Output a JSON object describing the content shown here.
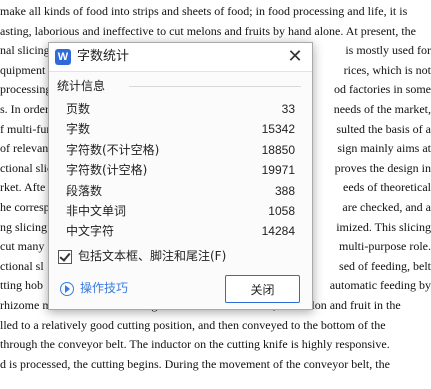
{
  "document": {
    "lines": [
      {
        "left": "make all kinds of food into strips and sheets of food; in food processing and life, it is",
        "right": ""
      },
      {
        "left": "asting, laborious and ineffective to cut melons and fruits by hand alone. At present, the",
        "right": ""
      },
      {
        "left": "nal slicing",
        "right": "is mostly used for"
      },
      {
        "left": "quipment",
        "right": "rices, which is not"
      },
      {
        "left": "processing",
        "right": "od factories in some"
      },
      {
        "left": "s. In order",
        "right": "needs of the market,"
      },
      {
        "left": "f multi-fun",
        "right": "sulted the basis of a"
      },
      {
        "left": "of relevan",
        "right": "sign mainly aims at"
      },
      {
        "left": "ctional slic",
        "right": "proves the design in"
      },
      {
        "left": "rket. Afte",
        "right": "eeds of theoretical"
      },
      {
        "left": "he corresp",
        "right": "are checked, and a"
      },
      {
        "left": "ng slicing",
        "right": "imized. This slicing"
      },
      {
        "left": "cut many",
        "right": "multi-purpose role."
      },
      {
        "left": "ctional sl",
        "right": "sed of feeding, belt"
      },
      {
        "left": "tting hob",
        "right": "automatic feeding by"
      },
      {
        "left": "rhizome melon and fruit. Through the rotation of the hob, the melon and fruit in the",
        "right": ""
      },
      {
        "left": "lled to a relatively good cutting position, and then conveyed to the bottom of the",
        "right": ""
      },
      {
        "left": "through the conveyor belt. The inductor on the cutting knife is highly responsive.",
        "right": ""
      },
      {
        "left": "d is processed, the cutting begins. During the movement of the conveyor belt, the",
        "right": ""
      }
    ]
  },
  "dialog": {
    "app_icon_letter": "W",
    "title": "字数统计",
    "close_glyph": "✕",
    "group_label": "统计信息",
    "stats": [
      {
        "label": "页数",
        "value": "33"
      },
      {
        "label": "字数",
        "value": "15342"
      },
      {
        "label": "字符数(不计空格)",
        "value": "18850"
      },
      {
        "label": "字符数(计空格)",
        "value": "19971"
      },
      {
        "label": "段落数",
        "value": "388"
      },
      {
        "label": "非中文单词",
        "value": "1058"
      },
      {
        "label": "中文字符",
        "value": "14284"
      }
    ],
    "include_checkbox": {
      "label": "包括文本框、脚注和尾注(F)",
      "checked": true
    },
    "tips_link": "操作技巧",
    "close_button": "关闭"
  },
  "colors": {
    "accent": "#2f6bd8",
    "link": "#3b7be0"
  },
  "icons": {
    "app": "wps-writer-icon",
    "close": "close-icon",
    "tips": "play-circle-icon",
    "checkbox": "checkmark-icon"
  }
}
